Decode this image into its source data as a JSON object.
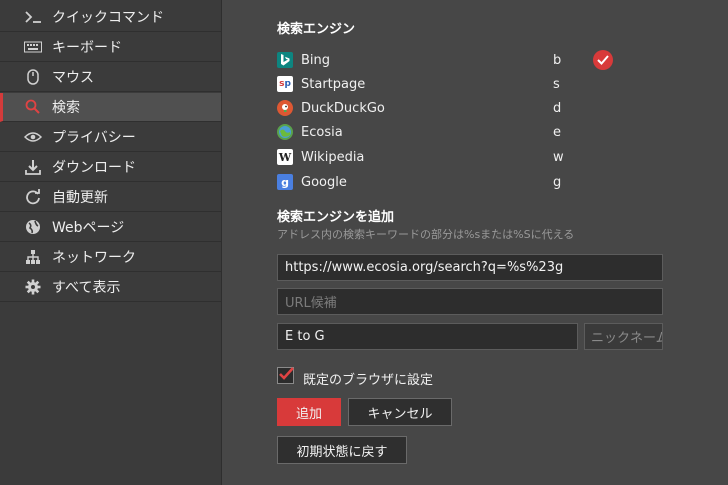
{
  "sidebar": {
    "items": [
      {
        "label": "クイックコマンド",
        "icon": "quick-command-icon"
      },
      {
        "label": "キーボード",
        "icon": "keyboard-icon"
      },
      {
        "label": "マウス",
        "icon": "mouse-icon"
      },
      {
        "label": "検索",
        "icon": "search-icon",
        "active": true
      },
      {
        "label": "プライバシー",
        "icon": "eye-icon"
      },
      {
        "label": "ダウンロード",
        "icon": "download-icon"
      },
      {
        "label": "自動更新",
        "icon": "refresh-icon"
      },
      {
        "label": "Webページ",
        "icon": "globe-icon"
      },
      {
        "label": "ネットワーク",
        "icon": "network-icon"
      },
      {
        "label": "すべて表示",
        "icon": "gear-icon"
      }
    ]
  },
  "search_engines": {
    "title": "検索エンジン",
    "engines": [
      {
        "name": "Bing",
        "key": "b",
        "default": true
      },
      {
        "name": "Startpage",
        "key": "s"
      },
      {
        "name": "DuckDuckGo",
        "key": "d"
      },
      {
        "name": "Ecosia",
        "key": "e"
      },
      {
        "name": "Wikipedia",
        "key": "w"
      },
      {
        "name": "Google",
        "key": "g"
      }
    ]
  },
  "add_engine": {
    "title": "検索エンジンを追加",
    "hint": "アドレス内の検索キーワードの部分は%sまたは%Sに代える",
    "url_value": "https://www.ecosia.org/search?q=%s%23g",
    "suggest_placeholder": "URL候補",
    "name_value": "E to G",
    "nickname_placeholder": "ニックネーム",
    "default_checkbox_label": "既定のブラウザに設定",
    "add_label": "追加",
    "cancel_label": "キャンセル",
    "reset_label": "初期状態に戻す"
  },
  "colors": {
    "accent": "#d83a3a",
    "background": "#474747",
    "sidebar": "#3b3b3b"
  }
}
